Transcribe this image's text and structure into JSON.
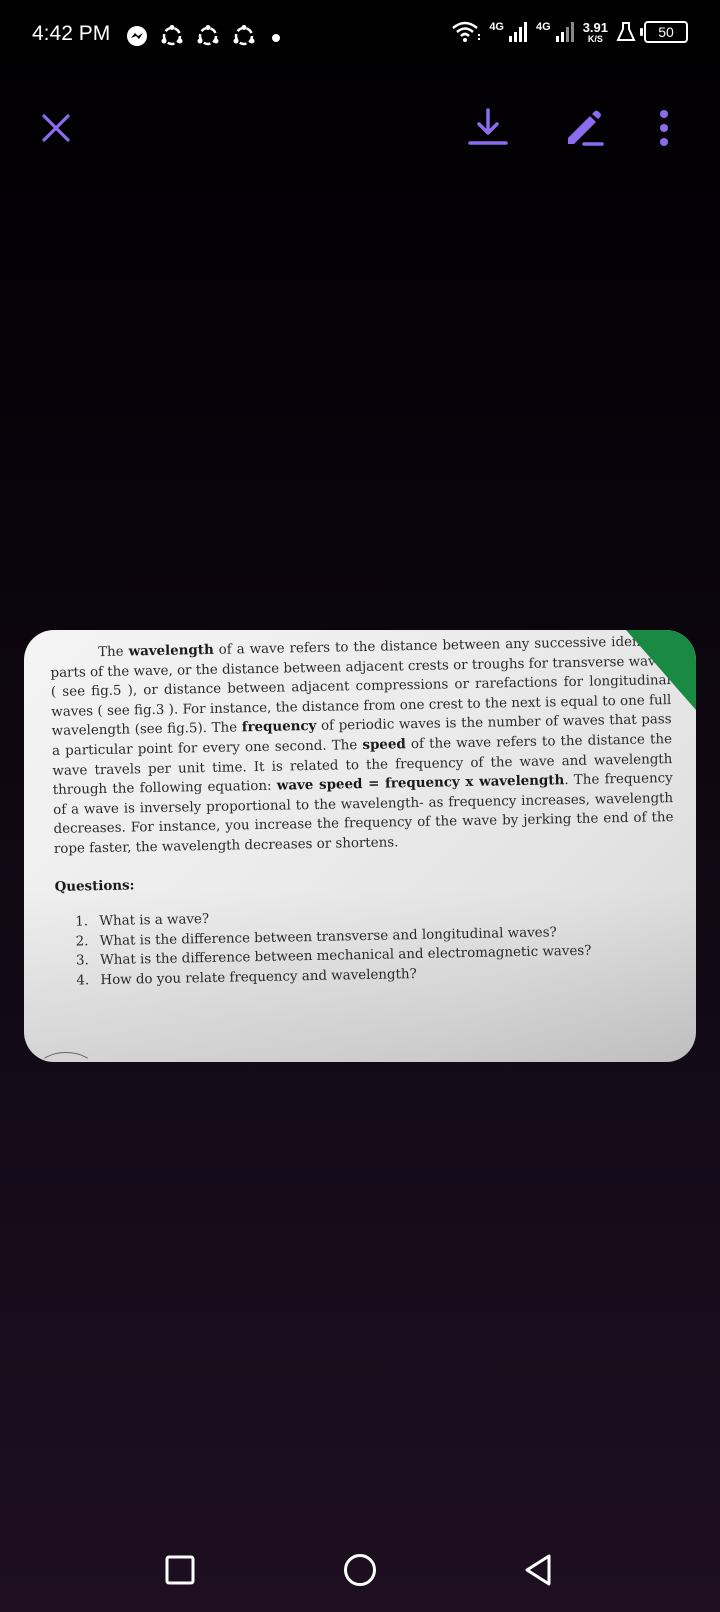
{
  "status_bar": {
    "time": "4:42 PM",
    "network_1": "4G",
    "network_2": "4G",
    "speed_value": "3.91",
    "speed_unit": "K/S",
    "battery": "50"
  },
  "document": {
    "paragraph": {
      "s1": "The ",
      "b1": "wavelength",
      "s2": " of a wave refers to the distance between any successive identical parts of the wave, or the distance between adjacent crests or troughs for transverse waves ( see fig.5 ), or distance between adjacent compressions or rarefactions for longitudinal waves ( see fig.3 ). For instance, the distance from one crest to the next is equal to one full wavelength (see fig.5). The ",
      "b2": "frequency",
      "s3": " of periodic waves is the number of waves that pass a particular point for every one second. The ",
      "b3": "speed",
      "s4": " of the wave refers to the distance the wave travels per unit time. It is related to the frequency of the wave and wavelength through the following equation: ",
      "b4": "wave speed = frequency x wavelength",
      "s5": ". The frequency of a wave is inversely proportional to the wavelength- as frequency increases, wavelength decreases. For instance, you increase the frequency of the wave by jerking the end of the rope faster, the wavelength decreases or shortens."
    },
    "questions_title": "Questions:",
    "questions": [
      {
        "num": "1.",
        "text": "What is a wave?"
      },
      {
        "num": "2.",
        "text": "What is the difference between transverse and longitudinal waves?"
      },
      {
        "num": "3.",
        "text": "What  is the difference between mechanical and electromagnetic waves?"
      },
      {
        "num": "4.",
        "text": "How do you relate frequency and wavelength?"
      }
    ]
  },
  "colors": {
    "accent": "#8b6cf0",
    "green_corner": "#1a8a43"
  },
  "icons": {
    "close": "close-icon",
    "download": "download-icon",
    "edit": "pen-icon",
    "more": "more-vertical-icon",
    "recents": "square-icon",
    "home": "circle-icon",
    "back": "triangle-back-icon"
  }
}
